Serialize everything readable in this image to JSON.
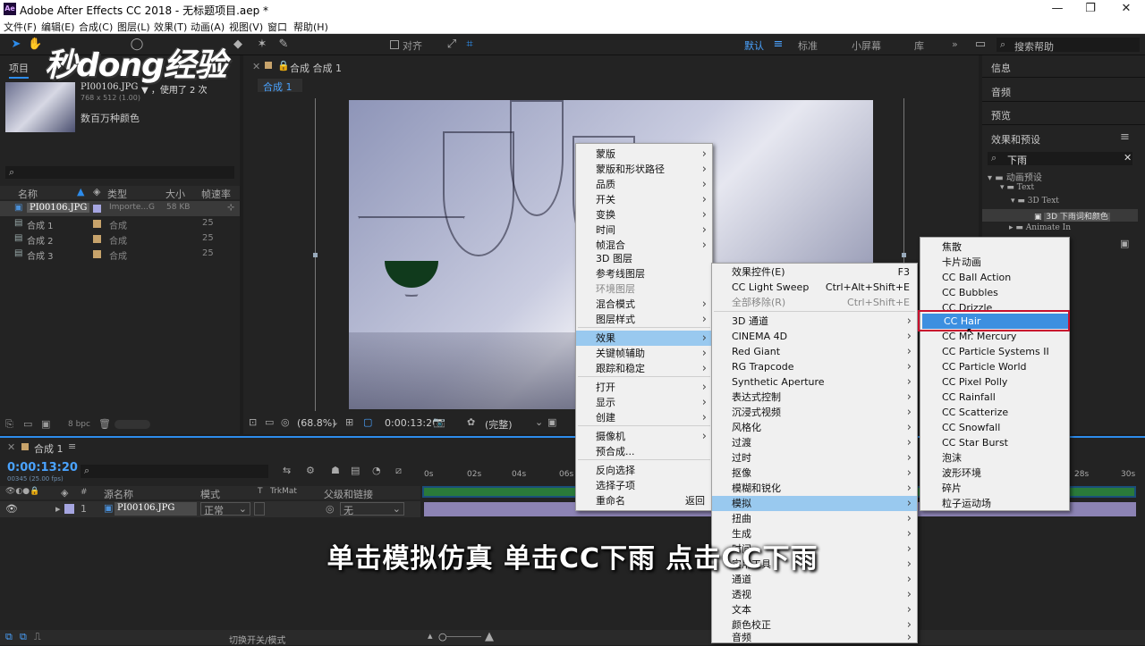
{
  "titlebar": {
    "title": "Adobe After Effects CC 2018 - 无标题项目.aep *",
    "logo": "Ae",
    "min": "—",
    "max": "❐",
    "close": "✕"
  },
  "menubar": [
    "文件(F)",
    "编辑(E)",
    "合成(C)",
    "图层(L)",
    "效果(T)",
    "动画(A)",
    "视图(V)",
    "窗口",
    "帮助(H)"
  ],
  "toolbar": {
    "snap_label": "对齐",
    "workspaces": [
      "默认",
      "标准",
      "小屏幕",
      "库"
    ],
    "search_placeholder": "搜索帮助",
    "more": "»"
  },
  "watermark": "秒dong经验",
  "project": {
    "tab": "项目",
    "file_name": "PI00106.JPG",
    "used": "▼ ，使用了 2 次",
    "dims": "768 x 512 (1.00)",
    "color": "数百万种颜色",
    "bpc": "8 bpc",
    "columns": [
      "名称",
      "类型",
      "大小",
      "帧速率"
    ],
    "items": [
      {
        "name": "PI00106.JPG",
        "type": "Importe...G",
        "size": "58 KB",
        "rate": ""
      },
      {
        "name": "合成 1",
        "type": "合成",
        "size": "",
        "rate": "25"
      },
      {
        "name": "合成 2",
        "type": "合成",
        "size": "",
        "rate": "25"
      },
      {
        "name": "合成 3",
        "type": "合成",
        "size": "",
        "rate": "25"
      }
    ]
  },
  "comp_viewer": {
    "tab": "合成 合成 1",
    "sub_tab": "合成 1",
    "zoom": "(68.8%)",
    "timecode": "0:00:13:20",
    "quality": "(完整)"
  },
  "right_panel": {
    "items": [
      "信息",
      "音频",
      "预览"
    ],
    "effects_title": "效果和预设",
    "search_value": "下雨",
    "tree": [
      "动画预设",
      "Text",
      "3D Text",
      "3D 下雨词和颜色",
      "Animate In"
    ]
  },
  "timeline": {
    "tab": "合成 1",
    "timecode": "0:00:13:20",
    "fps": "00345 (25.00 fps)",
    "ticks": [
      "0s",
      "02s",
      "04s",
      "06s",
      "28s",
      "30s"
    ],
    "columns": {
      "source": "源名称",
      "mode": "模式",
      "t": "T",
      "trkmat": "TrkMat",
      "parent": "父级和链接"
    },
    "layer": {
      "num": "1",
      "name": "PI00106.JPG",
      "mode": "正常",
      "parent": "无"
    },
    "footer": "切换开关/模式"
  },
  "context_menu": {
    "items": [
      {
        "label": "蒙版",
        "arrow": true
      },
      {
        "label": "蒙版和形状路径",
        "arrow": true
      },
      {
        "label": "品质",
        "arrow": true
      },
      {
        "label": "开关",
        "arrow": true
      },
      {
        "label": "变换",
        "arrow": true
      },
      {
        "label": "时间",
        "arrow": true
      },
      {
        "label": "帧混合",
        "arrow": true
      },
      {
        "label": "3D 图层"
      },
      {
        "label": "参考线图层"
      },
      {
        "label": "环境图层",
        "disabled": true
      },
      {
        "label": "混合模式",
        "arrow": true
      },
      {
        "label": "图层样式",
        "arrow": true
      },
      {
        "label": "效果",
        "arrow": true,
        "highlighted": true
      },
      {
        "label": "关键帧辅助",
        "arrow": true
      },
      {
        "label": "跟踪和稳定",
        "arrow": true
      },
      {
        "label": "打开",
        "arrow": true
      },
      {
        "label": "显示",
        "arrow": true
      },
      {
        "label": "创建",
        "arrow": true
      },
      {
        "label": "摄像机",
        "arrow": true
      },
      {
        "label": "预合成..."
      },
      {
        "label": "反向选择"
      },
      {
        "label": "选择子项"
      },
      {
        "label": "重命名",
        "shortcut": "返回"
      }
    ]
  },
  "effects_menu": {
    "items": [
      {
        "label": "效果控件(E)",
        "shortcut": "F3"
      },
      {
        "label": "CC Light Sweep",
        "shortcut": "Ctrl+Alt+Shift+E"
      },
      {
        "label": "全部移除(R)",
        "shortcut": "Ctrl+Shift+E",
        "disabled": true
      },
      {
        "label": "3D 通道",
        "arrow": true
      },
      {
        "label": "CINEMA 4D",
        "arrow": true
      },
      {
        "label": "Red Giant",
        "arrow": true
      },
      {
        "label": "RG Trapcode",
        "arrow": true
      },
      {
        "label": "Synthetic Aperture",
        "arrow": true
      },
      {
        "label": "表达式控制",
        "arrow": true
      },
      {
        "label": "沉浸式视频",
        "arrow": true
      },
      {
        "label": "风格化",
        "arrow": true
      },
      {
        "label": "过渡",
        "arrow": true
      },
      {
        "label": "过时",
        "arrow": true
      },
      {
        "label": "抠像",
        "arrow": true
      },
      {
        "label": "模糊和锐化",
        "arrow": true
      },
      {
        "label": "模拟",
        "arrow": true,
        "highlighted": true
      },
      {
        "label": "扭曲",
        "arrow": true
      },
      {
        "label": "生成",
        "arrow": true
      },
      {
        "label": "时间",
        "arrow": true
      },
      {
        "label": "实用工具",
        "arrow": true
      },
      {
        "label": "通道",
        "arrow": true
      },
      {
        "label": "透视",
        "arrow": true
      },
      {
        "label": "文本",
        "arrow": true
      },
      {
        "label": "颜色校正",
        "arrow": true
      },
      {
        "label": "音频",
        "arrow": true
      }
    ]
  },
  "simulate_menu": {
    "items": [
      {
        "label": "焦散"
      },
      {
        "label": "卡片动画"
      },
      {
        "label": "CC Ball Action"
      },
      {
        "label": "CC Bubbles"
      },
      {
        "label": "CC Drizzle"
      },
      {
        "label": "CC Hair",
        "highlighted": true
      },
      {
        "label": "CC Mr. Mercury"
      },
      {
        "label": "CC Particle Systems II"
      },
      {
        "label": "CC Particle World"
      },
      {
        "label": "CC Pixel Polly"
      },
      {
        "label": "CC Rainfall"
      },
      {
        "label": "CC Scatterize"
      },
      {
        "label": "CC Snowfall"
      },
      {
        "label": "CC Star Burst"
      },
      {
        "label": "泡沫"
      },
      {
        "label": "波形环境"
      },
      {
        "label": "碎片"
      },
      {
        "label": "粒子运动场"
      }
    ]
  },
  "subtitle": "单击模拟仿真  单击CC下雨  点击CC下雨",
  "colors": {
    "accent": "#2d8ceb",
    "highlight": "#99c9ef",
    "red_box": "#c8102e"
  }
}
